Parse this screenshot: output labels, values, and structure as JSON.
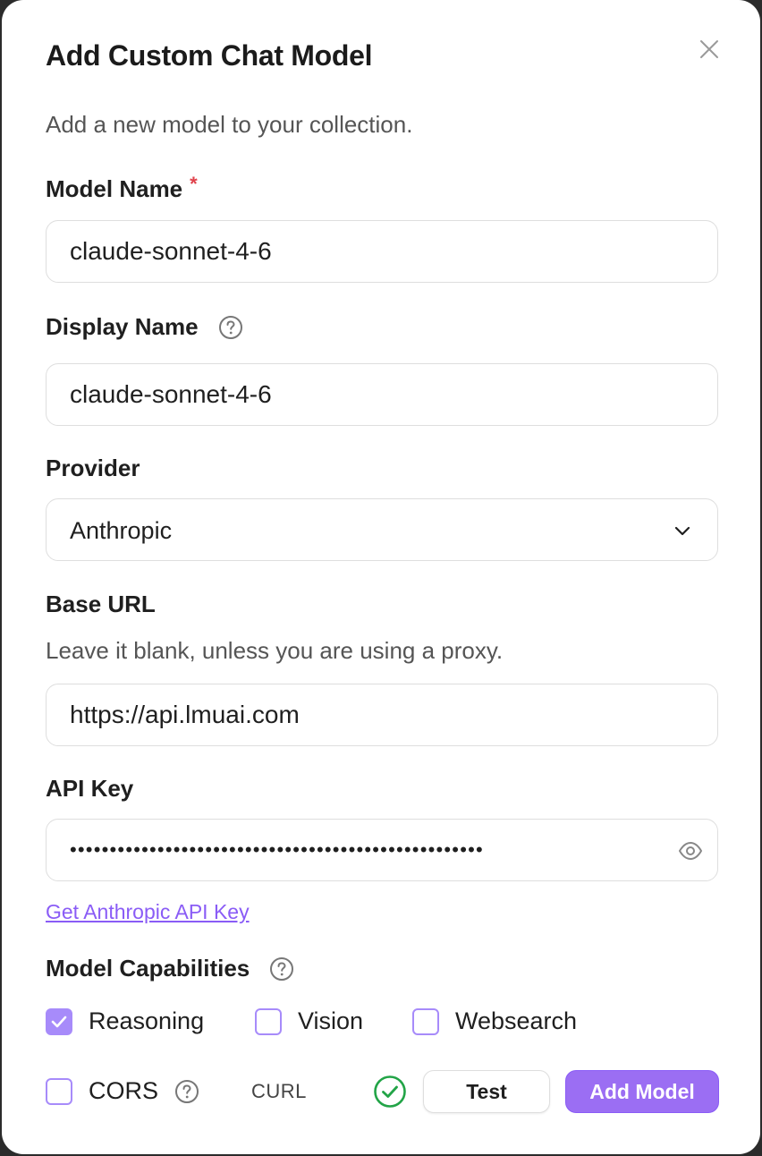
{
  "dialog": {
    "title": "Add Custom Chat Model",
    "subtitle": "Add a new model to your collection."
  },
  "model_name": {
    "label": "Model Name",
    "required_mark": "*",
    "value": "claude-sonnet-4-6"
  },
  "display_name": {
    "label": "Display Name",
    "value": "claude-sonnet-4-6"
  },
  "provider": {
    "label": "Provider",
    "selected": "Anthropic"
  },
  "base_url": {
    "label": "Base URL",
    "hint": "Leave it blank, unless you are using a proxy.",
    "value": "https://api.lmuai.com"
  },
  "api_key": {
    "label": "API Key",
    "masked_value": "••••••••••••••••••••••••••••••••••••••••••••••••••••",
    "link_text": "Get Anthropic API Key"
  },
  "capabilities": {
    "label": "Model Capabilities",
    "items": [
      {
        "label": "Reasoning",
        "checked": true
      },
      {
        "label": "Vision",
        "checked": false
      },
      {
        "label": "Websearch",
        "checked": false
      }
    ]
  },
  "footer": {
    "cors_label": "CORS",
    "cors_checked": false,
    "curl_label": "CURL",
    "test_label": "Test",
    "add_label": "Add Model",
    "status": "success"
  },
  "colors": {
    "accent": "#9b6ef3",
    "required": "#e0424b",
    "success": "#22a447",
    "link": "#8a5cf6"
  },
  "icons": {
    "close": "close-icon",
    "help": "help-circle-icon",
    "chevron": "chevron-down-icon",
    "eye": "eye-icon",
    "check": "check-icon",
    "status": "check-circle-icon"
  }
}
